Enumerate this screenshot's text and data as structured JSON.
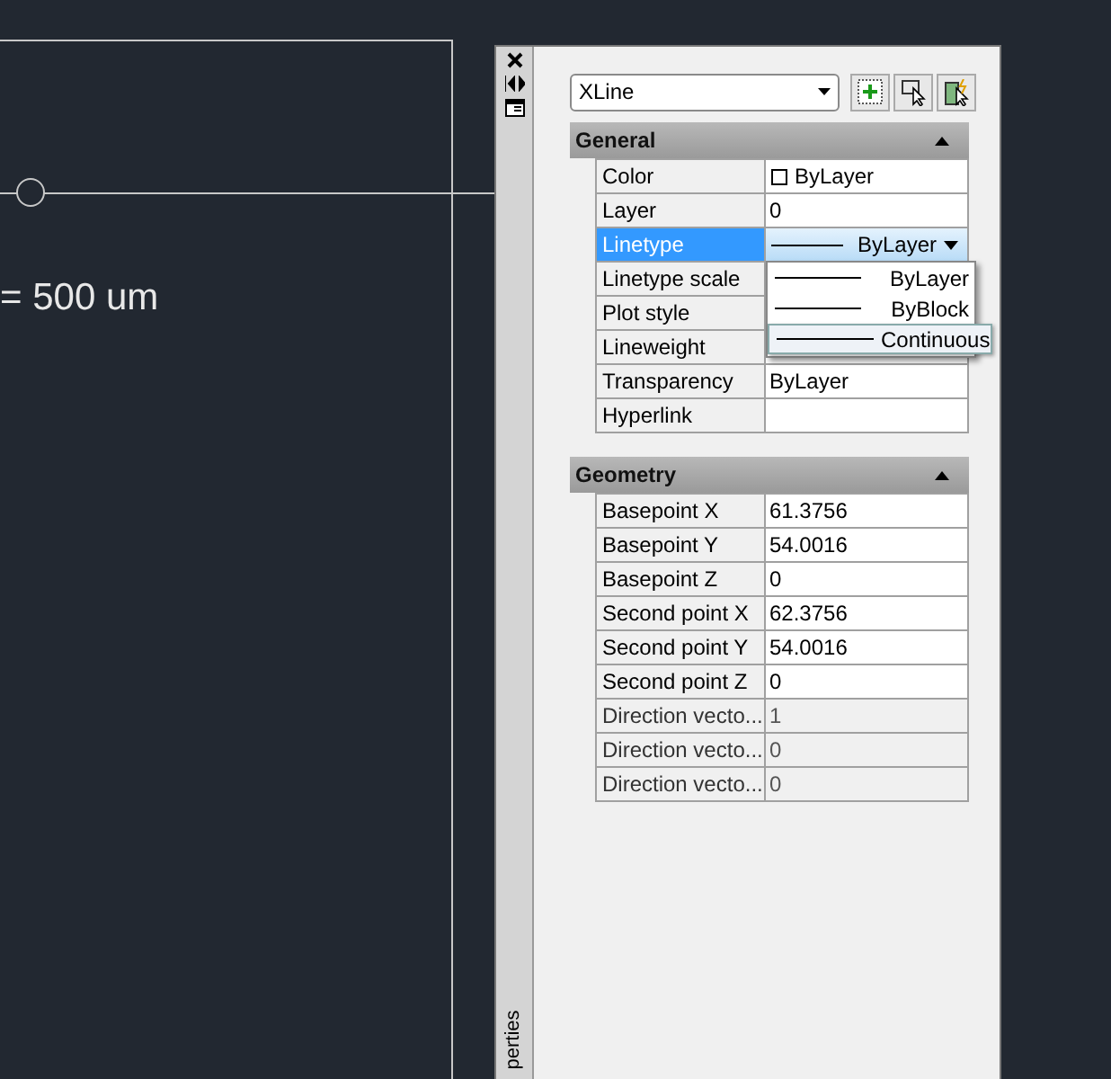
{
  "canvas": {
    "dimension_text": "= 500 um"
  },
  "palette": {
    "side_label": "perties",
    "object_type": "XLine",
    "sections": [
      {
        "title": "General",
        "expanded": true,
        "rows": [
          {
            "label": "Color",
            "value": "ByLayer",
            "kind": "color",
            "selected": false,
            "readonly": false
          },
          {
            "label": "Layer",
            "value": "0",
            "kind": "text",
            "selected": false,
            "readonly": false
          },
          {
            "label": "Linetype",
            "value": "ByLayer",
            "kind": "linetype",
            "selected": true,
            "readonly": false
          },
          {
            "label": "Linetype scale",
            "kind": "text",
            "selected": false,
            "readonly": false
          },
          {
            "label": "Plot style",
            "kind": "text",
            "selected": false,
            "readonly": false
          },
          {
            "label": "Lineweight",
            "kind": "text",
            "selected": false,
            "readonly": false
          },
          {
            "label": "Transparency",
            "value": "ByLayer",
            "kind": "text",
            "selected": false,
            "readonly": false
          },
          {
            "label": "Hyperlink",
            "kind": "text",
            "selected": false,
            "readonly": false
          }
        ]
      },
      {
        "title": "Geometry",
        "expanded": true,
        "rows": [
          {
            "label": "Basepoint X",
            "value": "61.3756",
            "kind": "text",
            "selected": false,
            "readonly": false
          },
          {
            "label": "Basepoint Y",
            "value": "54.0016",
            "kind": "text",
            "selected": false,
            "readonly": false
          },
          {
            "label": "Basepoint Z",
            "value": "0",
            "kind": "text",
            "selected": false,
            "readonly": false
          },
          {
            "label": "Second point X",
            "value": "62.3756",
            "kind": "text",
            "selected": false,
            "readonly": false
          },
          {
            "label": "Second point Y",
            "value": "54.0016",
            "kind": "text",
            "selected": false,
            "readonly": false
          },
          {
            "label": "Second point Z",
            "value": "0",
            "kind": "text",
            "selected": false,
            "readonly": false
          },
          {
            "label": "Direction vecto...",
            "value": "1",
            "kind": "text",
            "selected": false,
            "readonly": true
          },
          {
            "label": "Direction vecto...",
            "value": "0",
            "kind": "text",
            "selected": false,
            "readonly": true
          },
          {
            "label": "Direction vecto...",
            "value": "0",
            "kind": "text",
            "selected": false,
            "readonly": true
          }
        ]
      }
    ],
    "linetype_menu": {
      "options": [
        {
          "label": "ByLayer",
          "selected": false
        },
        {
          "label": "ByBlock",
          "selected": false
        },
        {
          "label": "Continuous",
          "selected": true
        }
      ]
    }
  }
}
